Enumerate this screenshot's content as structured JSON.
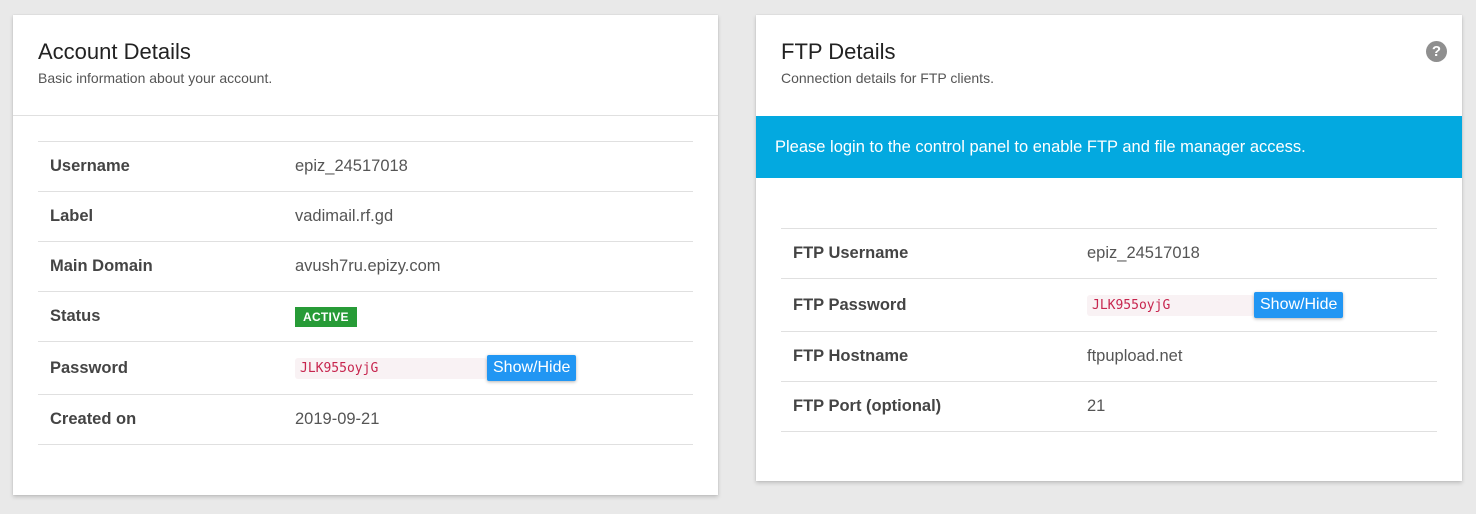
{
  "account": {
    "title": "Account Details",
    "subtitle": "Basic information about your account.",
    "rows": {
      "username": {
        "label": "Username",
        "value": "epiz_24517018"
      },
      "label": {
        "label": "Label",
        "value": "vadimail.rf.gd"
      },
      "domain": {
        "label": "Main Domain",
        "value": "avush7ru.epizy.com"
      },
      "status": {
        "label": "Status",
        "value": "ACTIVE"
      },
      "password": {
        "label": "Password",
        "value": "JLK955oyjG",
        "button": "Show/Hide"
      },
      "created": {
        "label": "Created on",
        "value": "2019-09-21"
      }
    }
  },
  "ftp": {
    "title": "FTP Details",
    "subtitle": "Connection details for FTP clients.",
    "help_icon": "?",
    "notice": "Please login to the control panel to enable FTP and file manager access.",
    "rows": {
      "username": {
        "label": "FTP Username",
        "value": "epiz_24517018"
      },
      "password": {
        "label": "FTP Password",
        "value": "JLK955oyjG",
        "button": "Show/Hide"
      },
      "hostname": {
        "label": "FTP Hostname",
        "value": "ftpupload.net"
      },
      "port": {
        "label": "FTP Port (optional)",
        "value": "21"
      }
    }
  },
  "colors": {
    "accent_button": "#2196f3",
    "notice_bg": "#03a9e0",
    "status_active": "#279b37",
    "code_text": "#c7254e"
  },
  "icons": {
    "help": "help-icon"
  }
}
